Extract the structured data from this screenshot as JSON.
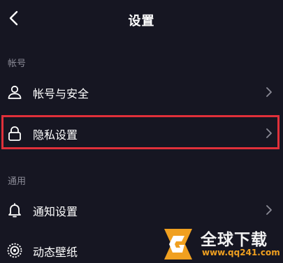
{
  "header": {
    "title": "设置"
  },
  "sections": [
    {
      "label": "帐号",
      "items": [
        {
          "label": "帐号与安全",
          "icon": "user-icon"
        },
        {
          "label": "隐私设置",
          "icon": "lock-icon",
          "highlighted": true
        }
      ]
    },
    {
      "label": "通用",
      "items": [
        {
          "label": "通知设置",
          "icon": "bell-icon"
        },
        {
          "label": "动态壁纸",
          "icon": "wallpaper-icon"
        }
      ]
    }
  ],
  "watermark": {
    "text": "全球下载",
    "url": "www.qq241.com"
  },
  "colors": {
    "background": "#161622",
    "text": "#ffffff",
    "muted": "#8a8a96",
    "highlight": "#e0303a",
    "watermark_accent": "#f0a020"
  }
}
